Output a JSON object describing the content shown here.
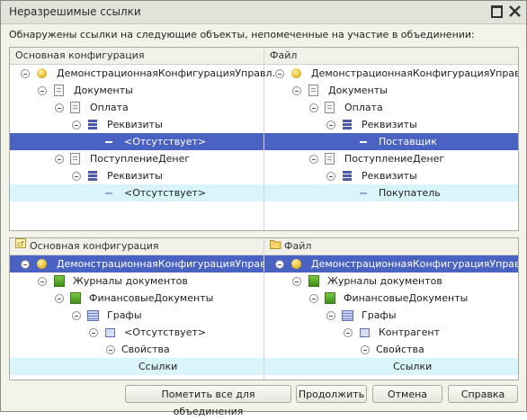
{
  "window": {
    "title": "Неразрешимые ссылки"
  },
  "message": "Обнаружены ссылки на следующие  объекты, непомеченные на участие в объединении:",
  "top": {
    "left": {
      "header": "Основная конфигурация",
      "rows": [
        {
          "label": "ДемонстрационнаяКонфигурацияУправл...",
          "icon": "config-icon"
        },
        {
          "label": "Документы",
          "icon": "documents-icon"
        },
        {
          "label": "Оплата",
          "icon": "document-icon"
        },
        {
          "label": "Реквизиты",
          "icon": "attributes-icon"
        },
        {
          "label": "<Отсутствует>",
          "icon": "attribute-icon"
        },
        {
          "label": "ПоступлениеДенег",
          "icon": "document-icon"
        },
        {
          "label": "Реквизиты",
          "icon": "attributes-icon"
        },
        {
          "label": "<Отсутствует>",
          "icon": "attribute-icon"
        }
      ]
    },
    "right": {
      "header": "Файл",
      "rows": [
        {
          "label": "ДемонстрационнаяКонфигурацияУправля...",
          "icon": "config-icon"
        },
        {
          "label": "Документы",
          "icon": "documents-icon"
        },
        {
          "label": "Оплата",
          "icon": "document-icon"
        },
        {
          "label": "Реквизиты",
          "icon": "attributes-icon"
        },
        {
          "label": "Поставщик",
          "icon": "attribute-icon"
        },
        {
          "label": "ПоступлениеДенег",
          "icon": "document-icon"
        },
        {
          "label": "Реквизиты",
          "icon": "attributes-icon"
        },
        {
          "label": "Покупатель",
          "icon": "attribute-icon"
        }
      ]
    }
  },
  "bottom": {
    "left": {
      "header": "Основная конфигурация",
      "rows": [
        {
          "label": "ДемонстрационнаяКонфигурацияУправл...",
          "icon": "config-icon"
        },
        {
          "label": "Журналы документов",
          "icon": "journals-icon"
        },
        {
          "label": "ФинансовыеДокументы",
          "icon": "journal-icon"
        },
        {
          "label": "Графы",
          "icon": "columns-icon"
        },
        {
          "label": "<Отсутствует>",
          "icon": "column-icon"
        },
        {
          "label": "Свойства",
          "icon": ""
        },
        {
          "label": "Ссылки",
          "icon": ""
        }
      ]
    },
    "right": {
      "header": "Файл",
      "rows": [
        {
          "label": "ДемонстрационнаяКонфигурацияУправля...",
          "icon": "config-icon"
        },
        {
          "label": "Журналы документов",
          "icon": "journals-icon"
        },
        {
          "label": "ФинансовыеДокументы",
          "icon": "journal-icon"
        },
        {
          "label": "Графы",
          "icon": "columns-icon"
        },
        {
          "label": "Контрагент",
          "icon": "column-icon"
        },
        {
          "label": "Свойства",
          "icon": ""
        },
        {
          "label": "Ссылки",
          "icon": ""
        }
      ]
    }
  },
  "buttons": {
    "mark_all": "Пометить все для объединения",
    "continue": "Продолжить",
    "cancel": "Отмена",
    "help": "Справка"
  },
  "colors": {
    "selection": "#4a63c3",
    "highlight": "#d9f4fa"
  }
}
